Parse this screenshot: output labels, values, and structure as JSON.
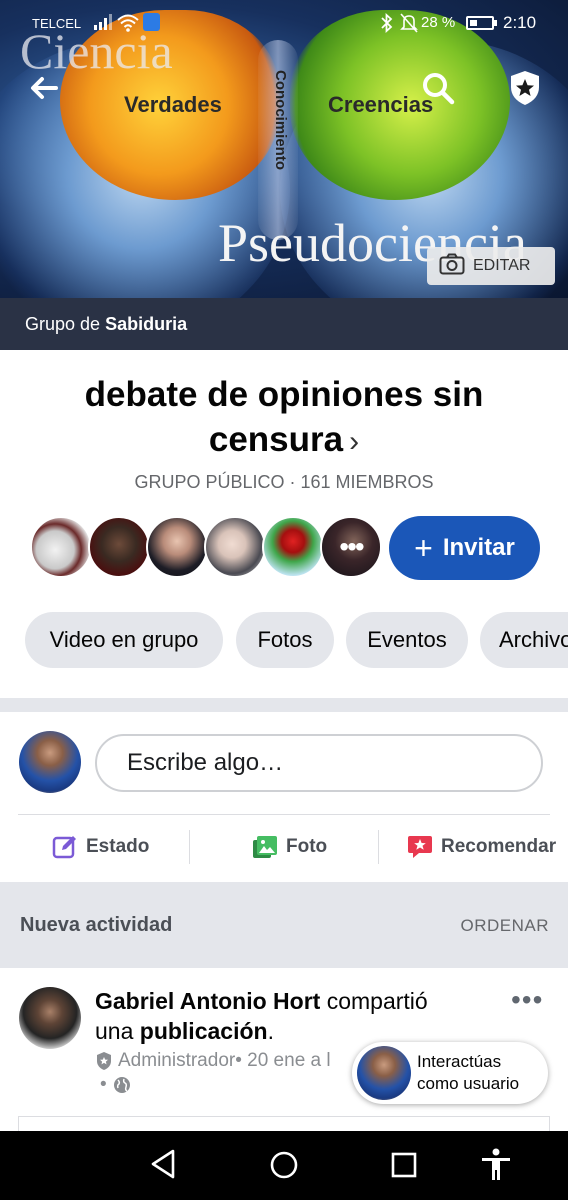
{
  "status_bar": {
    "carrier": "TELCEL",
    "battery_percent": "28 %",
    "time": "2:10"
  },
  "cover": {
    "text_ciencia": "Ciencia",
    "text_verdades": "Verdades",
    "text_creencias": "Creencias",
    "text_conocimiento": "Conocimiento",
    "text_pseudociencia": "Pseudociencia",
    "edit_label": "EDITAR"
  },
  "group_bar": {
    "prefix": "Grupo de",
    "name": "Sabiduria"
  },
  "group": {
    "title_line1": "debate de opiniones sin",
    "title_line2": "censura",
    "chevron": "›",
    "meta": "GRUPO PÚBLICO · 161 MIEMBROS",
    "more_members": "•••",
    "invite_plus": "+",
    "invite_label": "Invitar"
  },
  "chips": [
    "Video en grupo",
    "Fotos",
    "Eventos",
    "Archivos"
  ],
  "composer": {
    "placeholder": "Escribe algo…",
    "actions": {
      "estado": "Estado",
      "foto": "Foto",
      "recomendar": "Recomendar"
    }
  },
  "feed_header": {
    "title": "Nueva actividad",
    "sort": "ORDENAR"
  },
  "post": {
    "author": "Gabriel Antonio Hort",
    "action": " compartió",
    "action2": "una ",
    "object": "publicación",
    "period": ".",
    "role": "Administrador",
    "date": " • 20 ene a l",
    "more": "•••",
    "privacy_dot": "•"
  },
  "toast": {
    "line1": "Interactúas",
    "line2": "como usuario"
  },
  "colors": {
    "primary": "#1b57b8",
    "group_bar": "#2a3245",
    "chip_bg": "#e4e6eb",
    "estado_icon": "#7b5ad6",
    "foto_icon": "#45bd62",
    "recomendar_icon": "#e8384f"
  },
  "icons": {
    "back": "arrow-left-icon",
    "search": "search-icon",
    "admin_badge": "star-shield-icon",
    "camera": "camera-icon",
    "estado": "edit-icon",
    "foto": "photo-icon",
    "recomendar": "recommend-icon",
    "role": "shield-icon",
    "privacy": "globe-icon"
  }
}
